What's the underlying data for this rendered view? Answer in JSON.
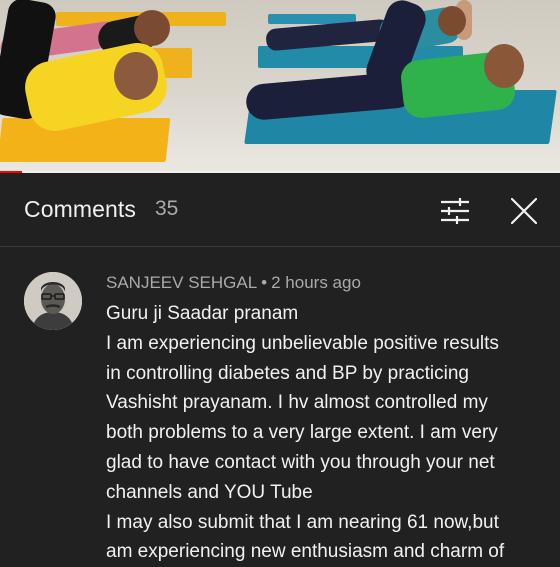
{
  "video": {
    "progress_fraction": 0.04,
    "progress_color": "#ff0000"
  },
  "header": {
    "title": "Comments",
    "count": "35",
    "sort_icon": "sort-sliders-icon",
    "close_icon": "close-icon"
  },
  "comment": {
    "author": "SANJEEV SEHGAL",
    "separator": "•",
    "time": "2 hours ago",
    "lines": [
      "Guru ji Saadar pranam",
      "I am experiencing unbelievable positive results",
      "in controlling diabetes and BP by practicing",
      "Vashisht prayanam. I hv almost controlled my",
      "both problems to a very large extent. I am very",
      "glad to have contact with you through your net",
      "channels and YOU Tube",
      "I may also submit that I am nearing 61 now,but",
      "am experiencing new enthusiasm and charm of"
    ]
  },
  "colors": {
    "background": "#212121",
    "text_primary": "#f1f1f1",
    "text_secondary": "#aaaaaa",
    "divider": "#3a3a3a"
  }
}
